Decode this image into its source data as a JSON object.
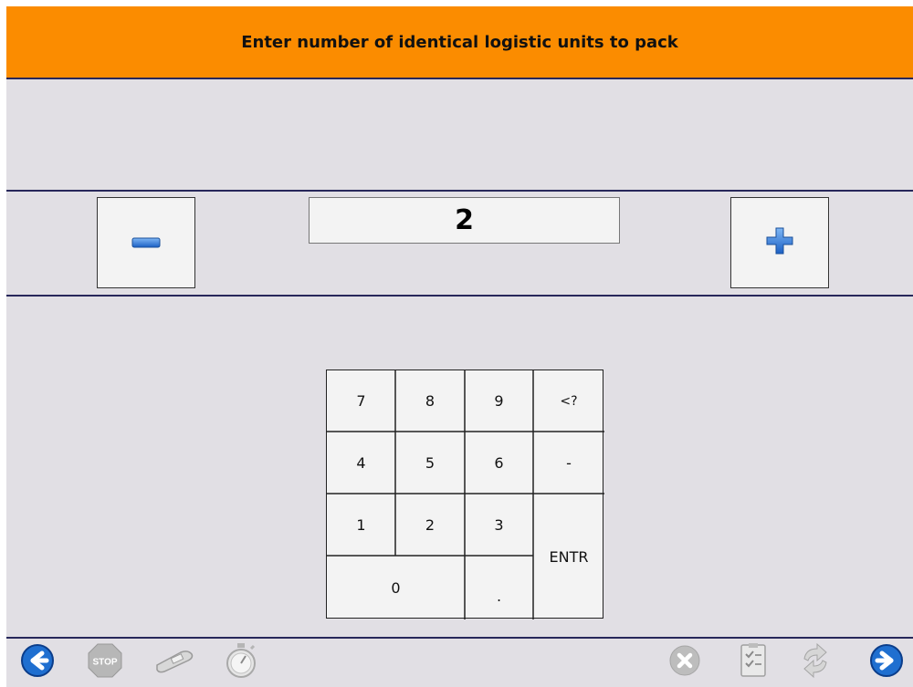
{
  "header": {
    "title": "Enter number of identical logistic units to pack"
  },
  "quantity": {
    "value": "2"
  },
  "keypad": {
    "keys": {
      "k7": "7",
      "k8": "8",
      "k9": "9",
      "backspace": "<?",
      "k4": "4",
      "k5": "5",
      "k6": "6",
      "minus": "-",
      "k1": "1",
      "k2": "2",
      "k3": "3",
      "enter": "ENTR",
      "k0": "0",
      "dot": "."
    }
  },
  "toolbar": {
    "stop_label": "STOP",
    "icons": [
      "back-arrow-icon",
      "stop-icon",
      "scanner-icon",
      "stopwatch-icon",
      "cancel-icon",
      "checklist-icon",
      "refresh-icon",
      "forward-arrow-icon"
    ]
  },
  "colors": {
    "header": "#fb8c00",
    "background": "#e1dfe4",
    "accent_blue": "#1f6fd0",
    "divider": "#27275a"
  }
}
